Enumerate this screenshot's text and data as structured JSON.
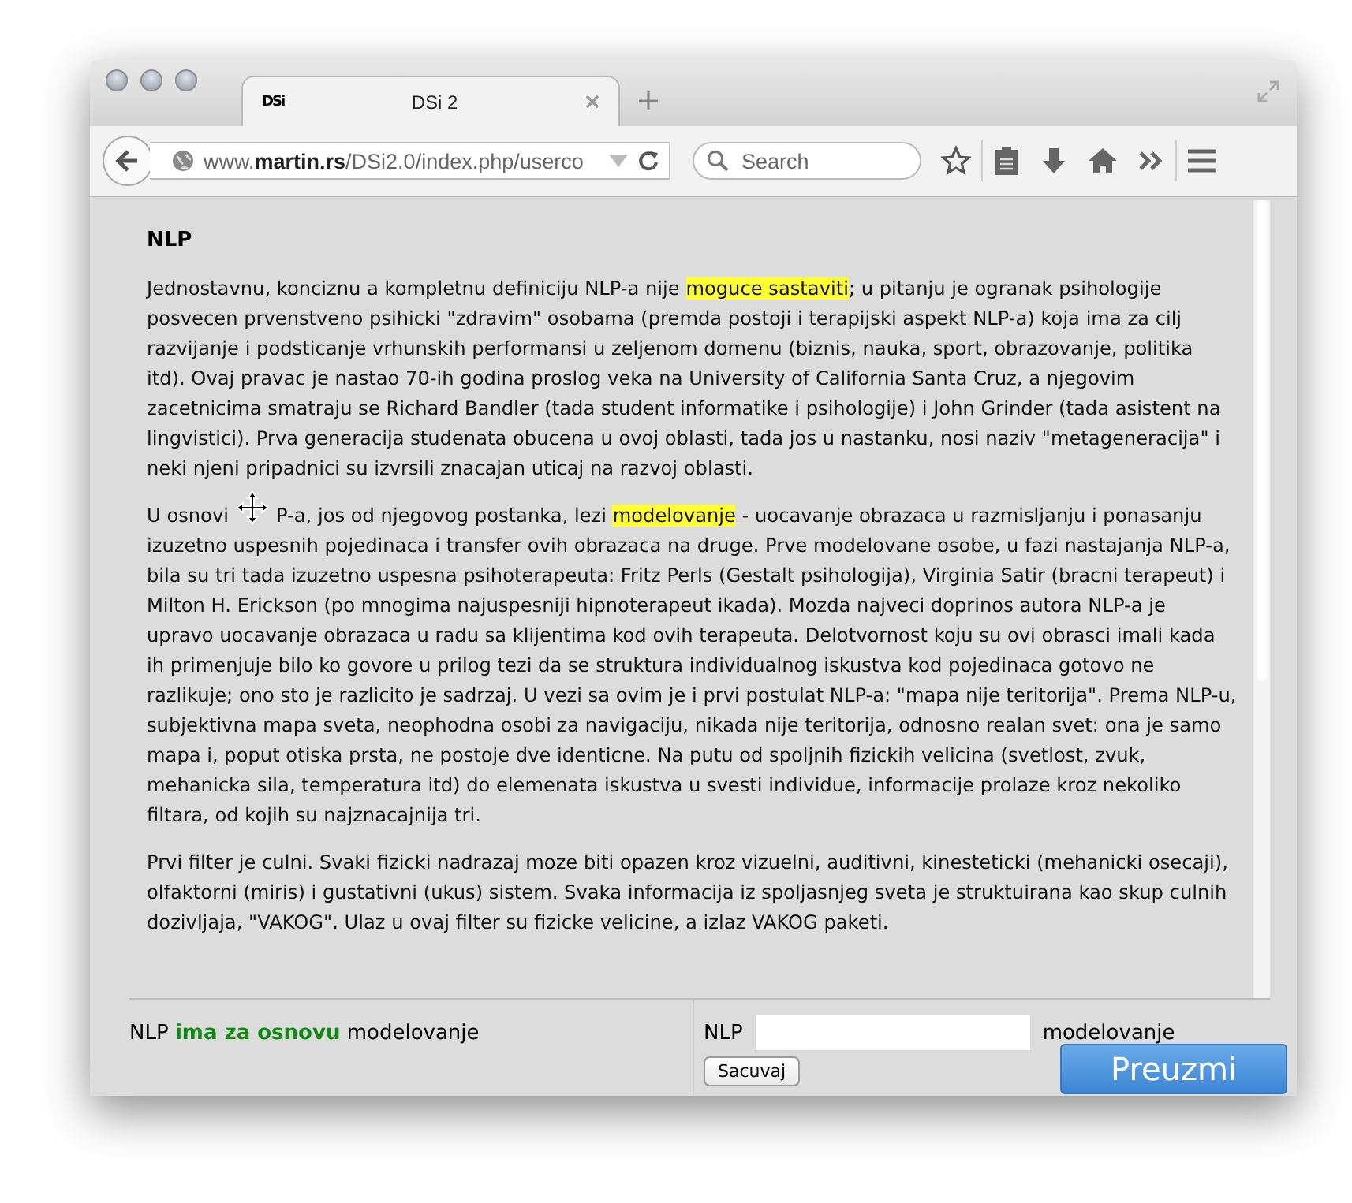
{
  "tab": {
    "favicon": "DSi",
    "title": "DSi 2",
    "selected": true
  },
  "address": {
    "url_host": "www.",
    "url_domain": "martin.rs",
    "url_path": "/DSi2.0/index.php/userco"
  },
  "search": {
    "placeholder": "Search"
  },
  "article": {
    "heading": "NLP",
    "paragraphs": [
      [
        {
          "text": "Jednostavnu, konciznu a kompletnu definiciju NLP-a nije ",
          "highlight": false
        },
        {
          "text": "moguce",
          "highlight": true
        },
        {
          "text": " sastaviti",
          "highlight": true
        },
        {
          "text": "; u pitanju je ogranak psihologije posvecen prvenstveno psihicki \"zdravim\" osobama (premda postoji i terapijski aspekt NLP-a) koja ima za cilj razvijanje i podsticanje vrhunskih performansi u zeljenom domenu (biznis, nauka, sport, obrazovanje, politika itd). Ovaj pravac je nastao 70-ih godina proslog veka na University of California Santa Cruz, a njegovim zacetnicima smatraju se Richard Bandler (tada student informatike i psihologije) i John Grinder (tada asistent na lingvistici). Prva generacija studenata obucena u ovoj oblasti, tada jos u nastanku, nosi naziv \"metageneracija\" i neki njeni pripadnici su izvrsili znacajan uticaj na razvoj oblasti.",
          "highlight": false
        }
      ],
      [
        {
          "text": "U osnovi",
          "highlight": false
        },
        {
          "text": "P-a, jos od njegovog postanka, lezi ",
          "highlight": false
        },
        {
          "text": "modelovanje",
          "highlight": true
        },
        {
          "text": " - uocavanje obrazaca u razmisljanju i ponasanju izuzetno uspesnih pojedinaca i transfer ovih obrazaca na druge. Prve modelovane osobe, u fazi nastajanja NLP-a, bila su tri tada izuzetno uspesna psihoterapeuta: Fritz Perls (Gestalt psihologija), Virginia Satir (bracni terapeut) i Milton H. Erickson (po mnogima najuspesniji hipnoterapeut ikada). Mozda najveci doprinos autora NLP-a je upravo uocavanje obrazaca u radu sa klijentima kod ovih terapeuta. Delotvornost koju su ovi obrasci imali kada ih primenjuje bilo ko govore u prilog tezi da se struktura individualnog iskustva kod pojedinaca gotovo ne razlikuje; ono sto je razlicito je sadrzaj. U vezi sa ovim je i prvi postulat NLP-a: \"mapa nije teritorija\". Prema NLP-u, subjektivna mapa sveta, neophodna osobi za navigaciju, nikada nije teritorija, odnosno realan svet: ona je samo mapa i, poput otiska prsta, ne postoje dve identicne. Na putu od spoljnih fizickih velicina (svetlost, zvuk, mehanicka sila, temperatura itd) do elemenata iskustva u svesti individue, informacije prolaze kroz nekoliko filtara, od kojih su najznacajnija tri.",
          "highlight": false
        }
      ],
      [
        {
          "text": "Prvi filter je culni. Svaki fizicki nadrazaj moze biti opazen kroz vizuelni, auditivni, kinesteticki (mehanicki osecaji), olfaktorni (miris) i gustativni (ukus) sistem. Svaka informacija iz spoljasnjeg sveta je struktuirana kao skup culnih dozivljaja, \"VAKOG\". Ulaz u ovaj filter su fizicke velicine, a izlaz VAKOG paketi.",
          "highlight": false
        }
      ]
    ]
  },
  "statement": "NLP **ima za osnovu** modelovanje",
  "answer": {
    "before": "NLP",
    "after": "modelovanje",
    "save_button": "Sacuvaj"
  },
  "download_button": "Preuzmi"
}
